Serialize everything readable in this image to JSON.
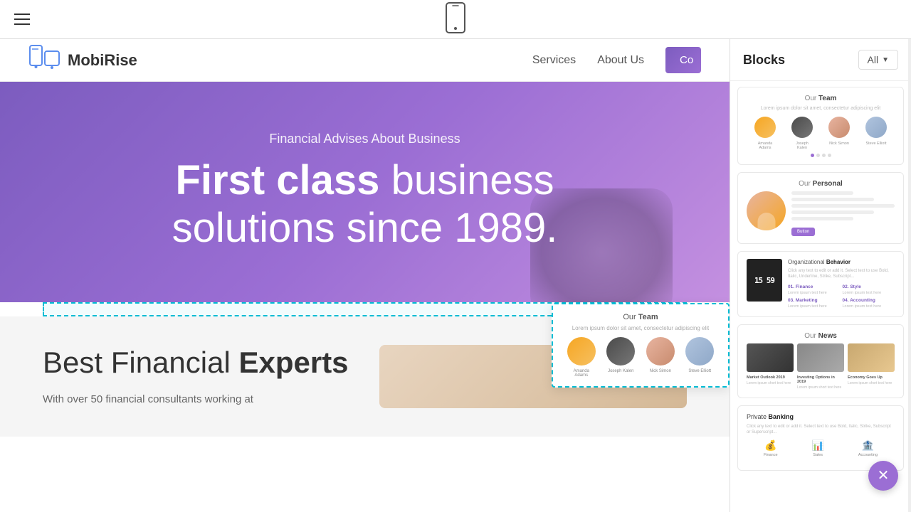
{
  "toolbar": {
    "phone_placeholder": "Phone preview"
  },
  "blocks_panel": {
    "title": "Blocks",
    "all_btn": "All",
    "blocks": [
      {
        "id": "our-team",
        "label_prefix": "Our",
        "label_main": "Team",
        "micro_text": "Lorem ipsum dolor sit amet, consectetur adipiscing elit",
        "avatars": [
          "Amanda Adams",
          "Joseph Kalen",
          "Nick Simon",
          "Steve Elliott"
        ],
        "dots": [
          true,
          false,
          false,
          false
        ]
      },
      {
        "id": "our-personal",
        "label_prefix": "Our",
        "label_main": "Personal"
      },
      {
        "id": "organizational-behavior",
        "label_main": "Organizational",
        "label_secondary": "Behavior",
        "time_display": "15 59",
        "sections": [
          "Finance",
          "Style",
          "Marketing",
          "Accounting"
        ]
      },
      {
        "id": "our-news",
        "label_prefix": "Our",
        "label_main": "News",
        "articles": [
          "Market Outlook 2019",
          "Investing Options in 2019",
          "Economy Goes Up"
        ]
      },
      {
        "id": "private-banking",
        "label_main": "Private",
        "label_secondary": "Banking",
        "icons": [
          "Finance",
          "Sales",
          "Accounting"
        ]
      }
    ]
  },
  "website": {
    "nav": {
      "logo_text": "MobiRise",
      "links": [
        "Services",
        "About Us"
      ],
      "btn_label": "Co"
    },
    "hero": {
      "subtitle": "Financial Advises About Business",
      "title_bold": "First class",
      "title_normal": "business solutions since 1989."
    },
    "team_preview": {
      "title_prefix": "Our",
      "title_main": "Team",
      "sub": "Lorem ipsum dolor sit amet, consectetur adipiscing elit",
      "members": [
        "Amanda Adams",
        "Joseph Kalen",
        "Nick Simon",
        "Steve Elliott"
      ]
    },
    "content": {
      "heading_normal": "Best Financial",
      "heading_bold": "Experts",
      "text": "With over 50 financial consultants working at"
    }
  }
}
